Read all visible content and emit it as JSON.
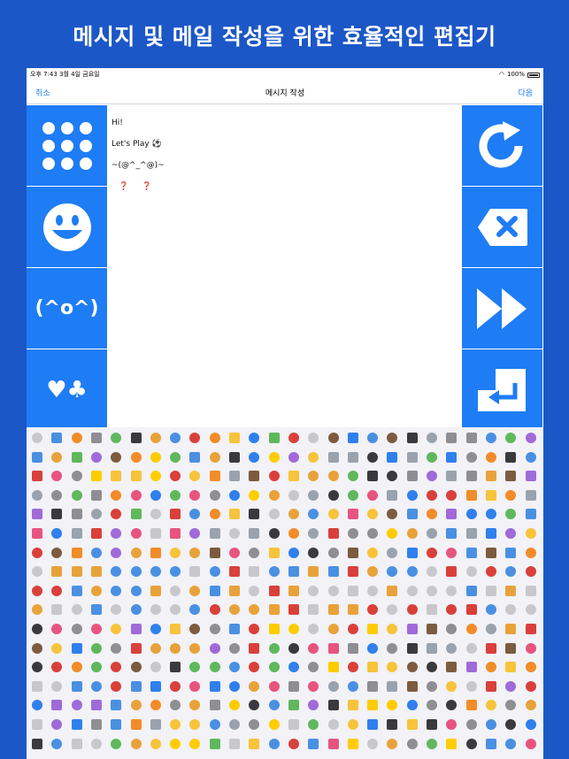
{
  "headline": "메시지 및 메일 작성을 위한 효율적인 편집기",
  "status": {
    "time_date": "오후 7:43   3월 4일 금요일",
    "battery": "100%"
  },
  "nav": {
    "cancel_label": "취소",
    "title": "메시지 작성",
    "next_label": "다음"
  },
  "editor": {
    "lines": [
      "Hi!",
      "Let's Play ⚽",
      "~(@^_^@)~",
      "❓ ❓"
    ]
  },
  "left_buttons": {
    "kaomoji_label": "(^o^)",
    "symbols_label": "♥♣"
  },
  "icons": {
    "left": [
      "grid-icon",
      "smiley-icon",
      "kaomoji-icon",
      "symbols-icon"
    ],
    "right": [
      "refresh-icon",
      "delete-icon",
      "fast-forward-icon",
      "return-icon"
    ]
  },
  "colors": {
    "background": "#1c57c8",
    "button": "#1e7cf5",
    "link": "#1e7cf5"
  },
  "emoji_palette": [
    "#f7c33b",
    "#e8a23a",
    "#d9403a",
    "#4a90e2",
    "#7c5b3e",
    "#9aa3ad",
    "#5fb85c",
    "#f28c28",
    "#c7c7cc",
    "#a06ad8",
    "#e75480",
    "#3a3a3c",
    "#ffcc00",
    "#8e8e93",
    "#2f80ed"
  ]
}
